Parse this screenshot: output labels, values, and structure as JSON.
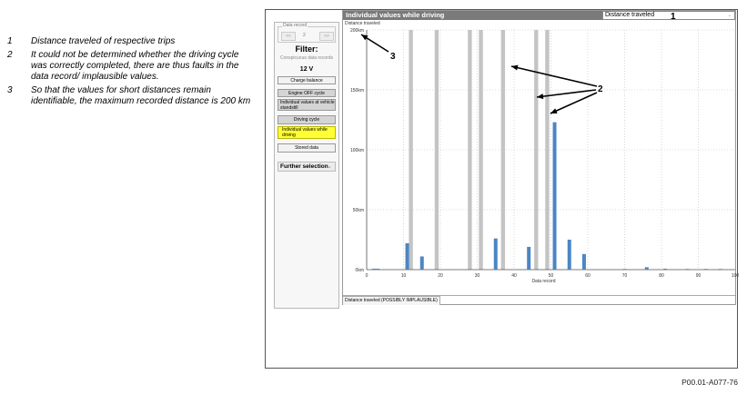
{
  "legend": [
    {
      "num": "1",
      "text": "Distance traveled of respective trips"
    },
    {
      "num": "2",
      "text": "It could not be determined whether the driving cycle was correctly completed, there are thus faults in the data record/ implausible values."
    },
    {
      "num": "3",
      "text": "So that the values for short distances remain identifiable, the maximum recorded distance is 200 km"
    }
  ],
  "sidebar": {
    "group_label": "Data record",
    "prev_label": "<<",
    "record_value": "2",
    "next_label": ">>",
    "filter_title": "Filter:",
    "filter_sub": "Conspicuous data records",
    "voltage": "12 V",
    "buttons": {
      "charge_balance": "Charge balance",
      "engine_off": "Engine OFF cycle",
      "standstill": "Individual values at vehicle standstill",
      "driving_cycle": "Driving cycle",
      "while_driving": "Individual values while driving",
      "stored_data": "Stored data"
    },
    "further": "Further selection",
    "further_icon": "chevron-down-icon"
  },
  "panel": {
    "title": "Individual values while driving",
    "select_value": "Distance traveled",
    "select_icon": "chevron-down-icon",
    "subtitle": "Distance traveled",
    "bottom_tab": "Distance traveled (POSSIBLY IMPLAUSIBLE)"
  },
  "callouts": {
    "c1": "1",
    "c2": "2",
    "c3": "3"
  },
  "caption": "P00.01-A077-76",
  "colors": {
    "bar": "#4a86c5",
    "implausible": "#c4c4c4",
    "highlight": "#ffff33",
    "titlebar": "#7a7a7a"
  },
  "chart_data": {
    "type": "bar",
    "xlabel": "Data record",
    "ylabel": "",
    "xlim": [
      0,
      100
    ],
    "ylim": [
      0,
      200
    ],
    "y_unit": "km",
    "xticks": [
      0,
      10,
      20,
      30,
      40,
      50,
      60,
      70,
      80,
      90,
      100
    ],
    "yticks": [
      0,
      50,
      100,
      150,
      200
    ],
    "ytick_labels": [
      "0km",
      "50km",
      "100km",
      "150km",
      "200km"
    ],
    "grid": true,
    "series": [
      {
        "values": [
          [
            2,
            0.8
          ],
          [
            3,
            0.8
          ],
          [
            11,
            22
          ],
          [
            15,
            11
          ],
          [
            35,
            26
          ],
          [
            44,
            19
          ],
          [
            51,
            123
          ],
          [
            55,
            25
          ],
          [
            59,
            13
          ],
          [
            70,
            0.6
          ],
          [
            76,
            2
          ],
          [
            81,
            0.8
          ],
          [
            87,
            0.6
          ],
          [
            92,
            0.6
          ],
          [
            96,
            0.6
          ]
        ]
      }
    ],
    "implausible_records": [
      12,
      19,
      28,
      31,
      37,
      46,
      49
    ]
  }
}
